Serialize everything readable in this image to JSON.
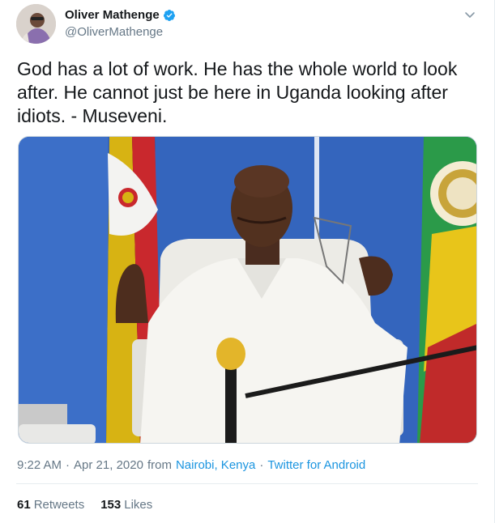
{
  "user": {
    "display_name": "Oliver Mathenge",
    "handle": "@OliverMathenge",
    "verified": true,
    "verified_color": "#1da1f2"
  },
  "tweet": {
    "text": "God has a lot of work. He has the whole world to look after. He cannot just be here in Uganda looking after idiots. - Museveni."
  },
  "meta": {
    "time": "9:22 AM",
    "date": "Apr 21, 2020",
    "from_text": "from",
    "location": "Nairobi, Kenya",
    "separator": "·",
    "source": "Twitter for Android"
  },
  "stats": {
    "retweets_count": "61",
    "retweets_label": "Retweets",
    "likes_count": "153",
    "likes_label": "Likes"
  },
  "icons": {
    "verified": "verified-badge-icon",
    "menu": "chevron-down-icon"
  },
  "colors": {
    "link": "#1b95e0",
    "secondary_text": "#657786",
    "primary_text": "#14171a"
  }
}
